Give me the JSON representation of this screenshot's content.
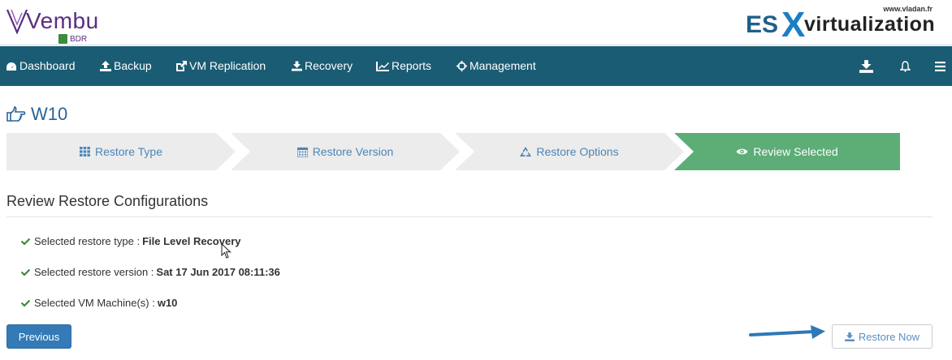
{
  "brand": {
    "name": "Vembu",
    "product": "BDR"
  },
  "watermark": {
    "url": "www.vladan.fr",
    "es": "ES",
    "x": "X",
    "virtualization": "virtualization"
  },
  "nav": {
    "items": [
      {
        "label": "Dashboard",
        "icon": "dashboard-icon"
      },
      {
        "label": "Backup",
        "icon": "upload-icon"
      },
      {
        "label": "VM Replication",
        "icon": "external-link-icon"
      },
      {
        "label": "Recovery",
        "icon": "download-icon"
      },
      {
        "label": "Reports",
        "icon": "line-chart-icon"
      },
      {
        "label": "Management",
        "icon": "crosshairs-icon"
      }
    ],
    "right_icons": [
      "download-icon",
      "bell-icon",
      "menu-icon"
    ]
  },
  "page": {
    "title": "W10",
    "title_icon": "hand-pointer-icon"
  },
  "wizard": {
    "steps": [
      {
        "label": "Restore Type",
        "icon": "grid-icon",
        "active": false
      },
      {
        "label": "Restore Version",
        "icon": "calendar-icon",
        "active": false
      },
      {
        "label": "Restore Options",
        "icon": "recycle-icon",
        "active": false
      },
      {
        "label": "Review Selected",
        "icon": "eye-icon",
        "active": true
      }
    ],
    "colors": {
      "inactive_bg": "#ececec",
      "active_bg": "#5cad76",
      "inactive_text": "#4a86b8"
    }
  },
  "review": {
    "heading": "Review Restore Configurations",
    "lines": [
      {
        "label": "Selected restore type :",
        "value": "File Level Recovery"
      },
      {
        "label": "Selected restore version :",
        "value": "Sat 17 Jun 2017 08:11:36"
      },
      {
        "label": "Selected VM Machine(s) :",
        "value": "w10"
      }
    ],
    "check_color": "#3c8a3c"
  },
  "actions": {
    "previous_label": "Previous",
    "restore_label": "Restore Now"
  },
  "colors": {
    "navbar": "#1a5c73",
    "brand_purple": "#5b2d83",
    "primary": "#337ab7",
    "arrow": "#2e78b7"
  }
}
